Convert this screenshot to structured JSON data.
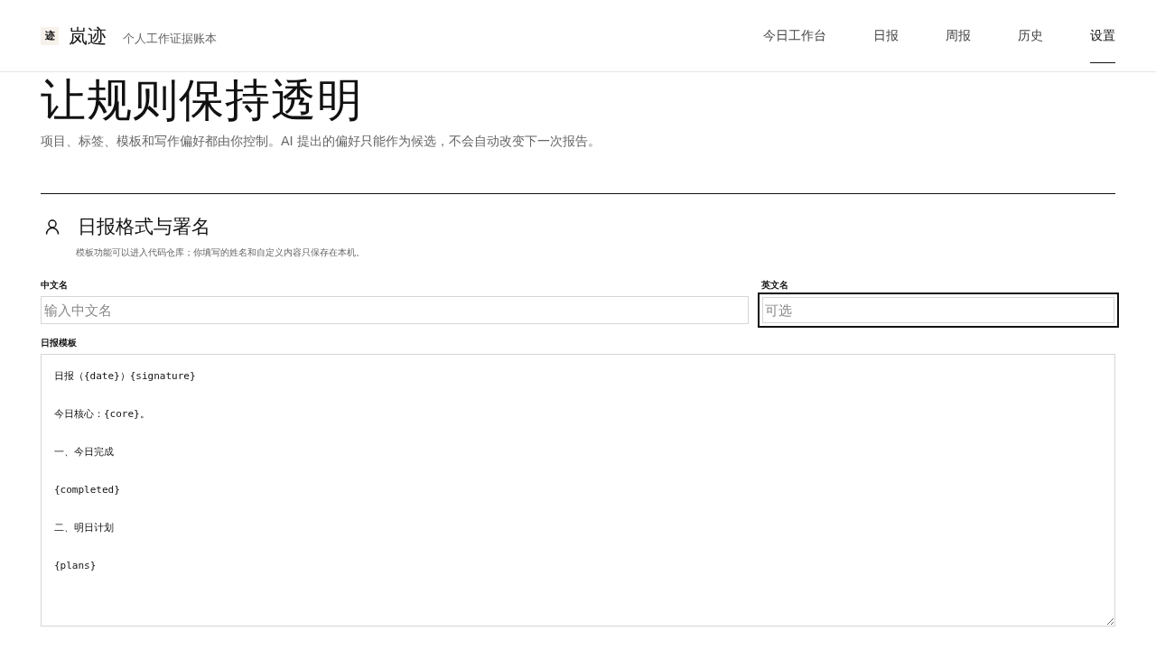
{
  "brand": {
    "logo": "迹",
    "name": "岚迹",
    "tagline": "个人工作证据账本"
  },
  "nav": [
    {
      "label": "今日工作台",
      "selected": false
    },
    {
      "label": "日报",
      "selected": false
    },
    {
      "label": "周报",
      "selected": false
    },
    {
      "label": "历史",
      "selected": false
    },
    {
      "label": "设置",
      "selected": true
    }
  ],
  "page": {
    "title": "让规则保持透明",
    "subtitle": "项目、标签、模板和写作偏好都由你控制。AI 提出的偏好只能作为候选，不会自动改变下一次报告。"
  },
  "section": {
    "title": "日报格式与署名",
    "note": "模板功能可以进入代码仓库；你填写的姓名和自定义内容只保存在本机。",
    "fields": [
      {
        "label": "中文名",
        "placeholder": "输入中文名",
        "focused": false
      },
      {
        "label": "英文名",
        "placeholder": "可选",
        "focused": true
      }
    ],
    "template": {
      "label": "日报模板",
      "lines": [
        "日报（{date}）{signature}",
        "今日核心：{core}。",
        "一、今日完成",
        "{completed}",
        "二、明日计划",
        "{plans}"
      ]
    }
  }
}
